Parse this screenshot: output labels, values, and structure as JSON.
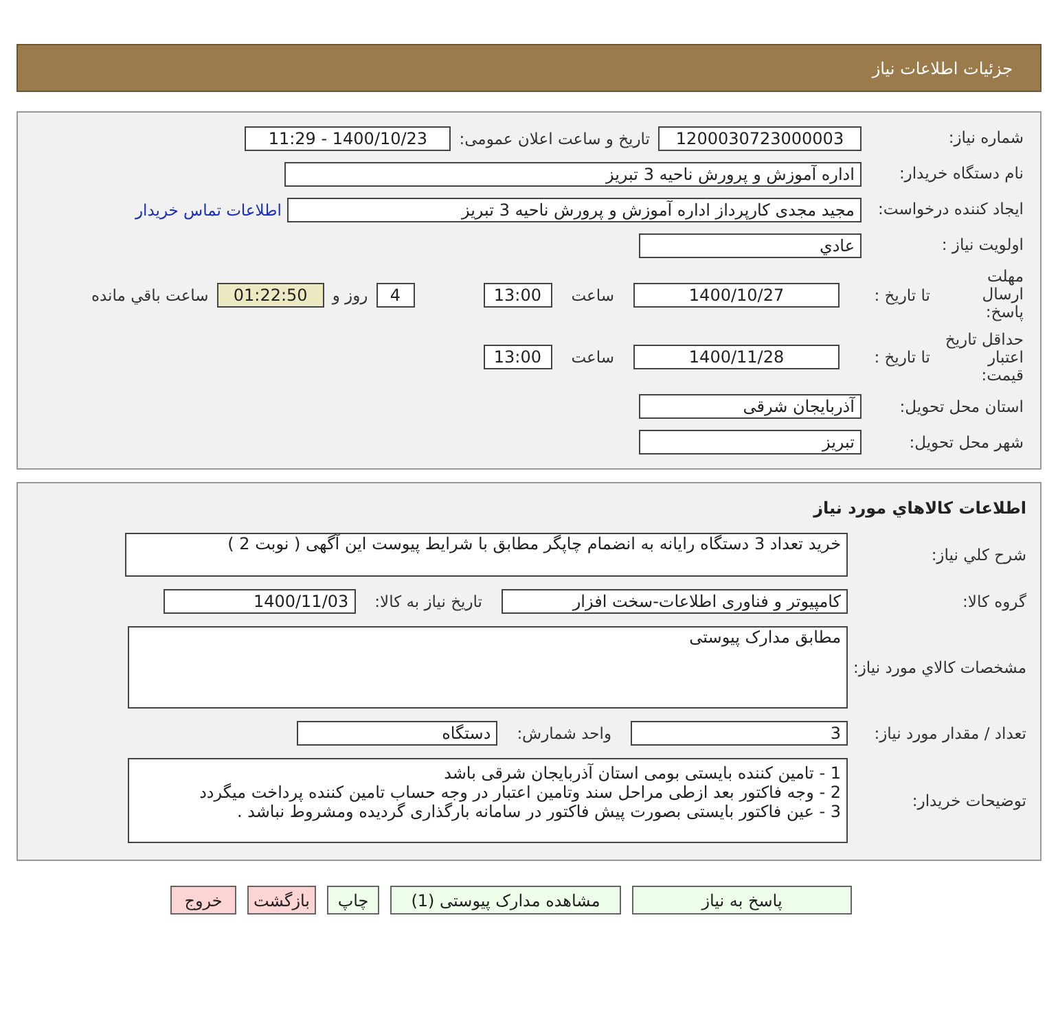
{
  "header": {
    "title": "جزئیات اطلاعات نیاز"
  },
  "details": {
    "need_number": {
      "label": "شماره نیاز:",
      "value": "1200030723000003"
    },
    "announce": {
      "label": "تاریخ و ساعت اعلان عمومی:",
      "value": "1400/10/23 - 11:29"
    },
    "buyer": {
      "label": "نام دستگاه خریدار:",
      "value": "اداره آموزش و پرورش ناحیه 3 تبریز"
    },
    "creator": {
      "label": "ایجاد کننده درخواست:",
      "value": "مجید مجدی کارپرداز اداره آموزش و پرورش ناحیه 3 تبریز"
    },
    "contact_link": "اطلاعات تماس خریدار",
    "priority": {
      "label": "اولویت نیاز :",
      "value": "عادي"
    },
    "deadline": {
      "label": "مهلت ارسال پاسخ:",
      "to_label": "تا تاریخ :",
      "date": "1400/10/27",
      "time_label": "ساعت",
      "time": "13:00",
      "days": "4",
      "days_label": "روز و",
      "remaining": "01:22:50",
      "remaining_label": "ساعت باقي مانده"
    },
    "validity": {
      "label": "حداقل تاریخ اعتبار قیمت:",
      "to_label": "تا تاریخ :",
      "date": "1400/11/28",
      "time_label": "ساعت",
      "time": "13:00"
    },
    "province": {
      "label": "استان محل تحویل:",
      "value": "آذربایجان شرقی"
    },
    "city": {
      "label": "شهر محل تحویل:",
      "value": "تبریز"
    }
  },
  "goods": {
    "title": "اطلاعات كالاهاي مورد نياز",
    "description": {
      "label": "شرح كلي نياز:",
      "value": "خرید تعداد 3 دستگاه رایانه به انضمام  چاپگر مطابق با شرایط پیوست این آگهی ( نوبت 2 )"
    },
    "group": {
      "label": "گروه کالا:",
      "value": "کامپیوتر و فناوری اطلاعات-سخت افزار"
    },
    "need_date": {
      "label": "تاریخ نیاز به کالا:",
      "value": "1400/11/03"
    },
    "specs": {
      "label": "مشخصات كالاي مورد نياز:",
      "value": "مطابق مدارک پیوستی"
    },
    "quantity": {
      "label": "تعداد / مقدار مورد نیاز:",
      "value": "3"
    },
    "unit": {
      "label": "واحد شمارش:",
      "value": "دستگاه"
    },
    "notes": {
      "label": "توضیحات خریدار:",
      "lines": [
        " 1 - تامین کننده بایستی بومی استان آذربایجان شرقی باشد",
        "2 - وجه فاکتور بعد ازطی مراحل سند وتامین اعتبار در وجه حساب تامین کننده پرداخت میگردد",
        "3 - عین فاکتور بایستی بصورت پیش فاکتور در سامانه بارگذاری گردیده ومشروط نباشد ."
      ]
    }
  },
  "buttons": [
    {
      "label": "پاسخ به نیاز",
      "kind": "primary"
    },
    {
      "label": "مشاهده مدارک پیوستی (1)",
      "kind": "primary"
    },
    {
      "label": "چاپ",
      "kind": "primary"
    },
    {
      "label": "بازگشت",
      "kind": "danger"
    },
    {
      "label": "خروج",
      "kind": "danger"
    }
  ]
}
